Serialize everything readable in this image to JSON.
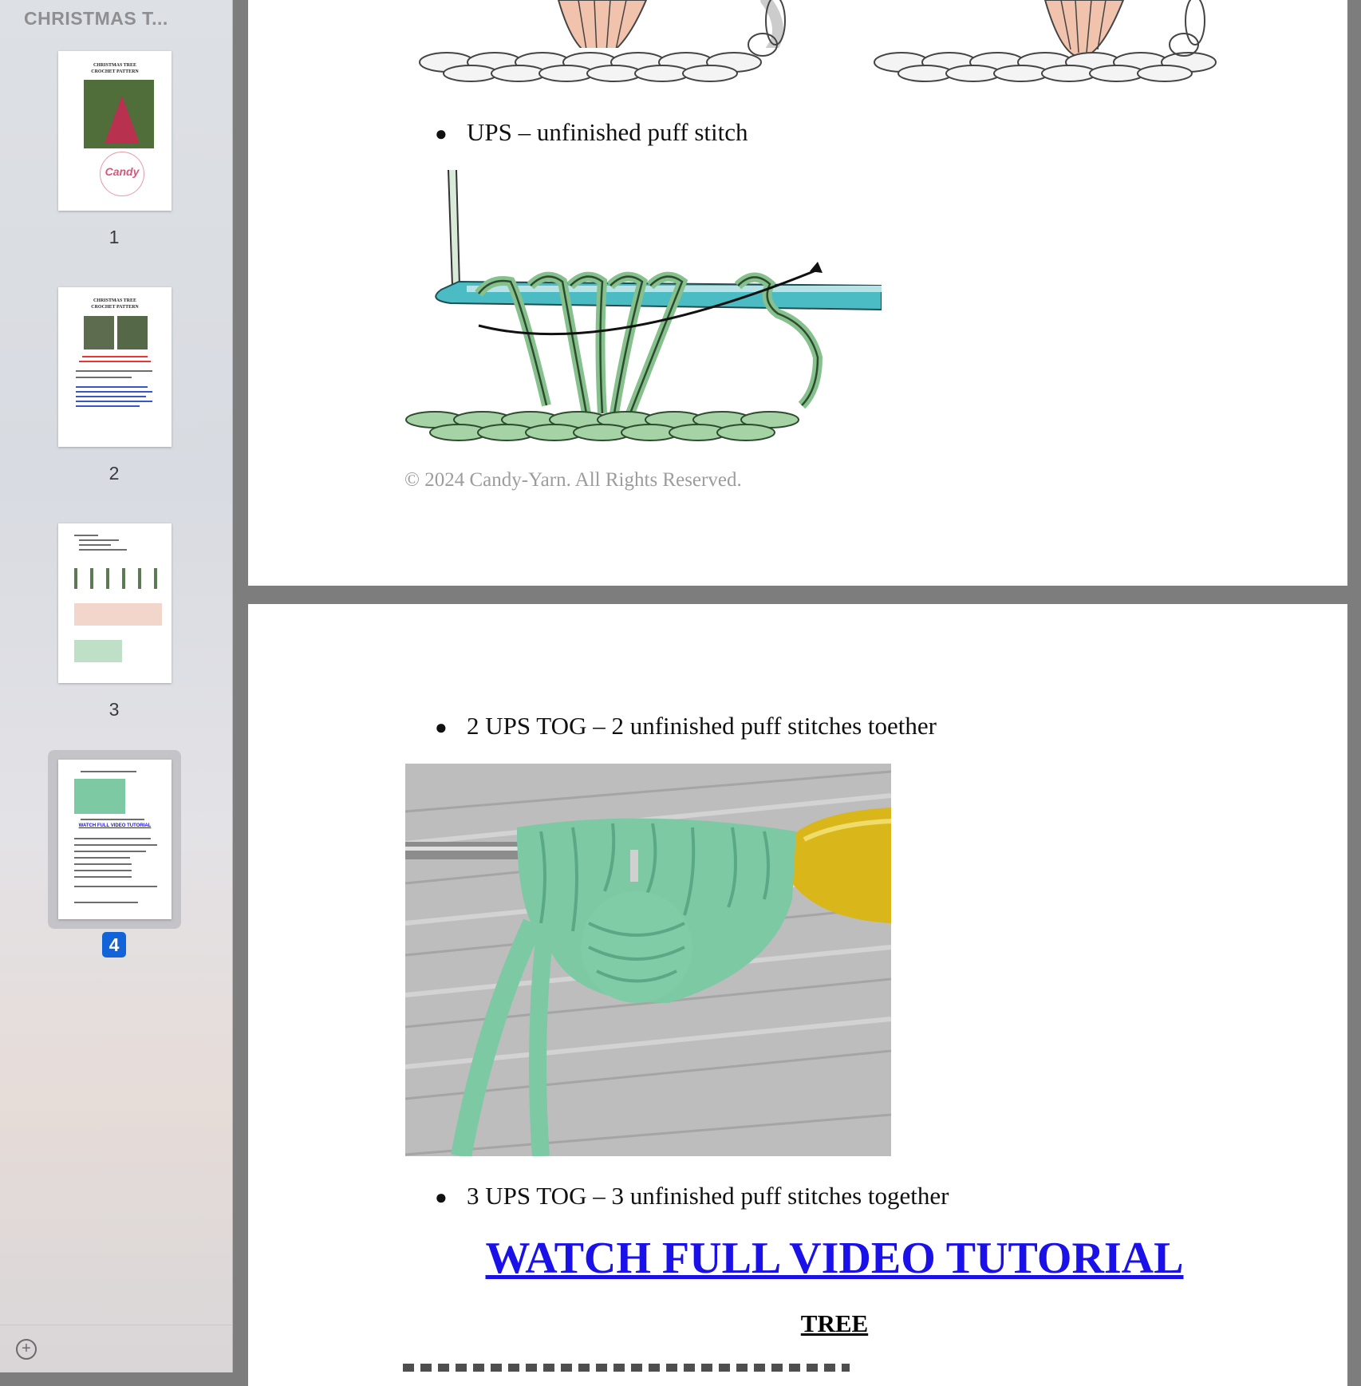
{
  "sidebar": {
    "doc_title": "CHRISTMAS T...",
    "pages": [
      {
        "number": "1",
        "title": "CHRISTMAS TREE\nCROCHET PATTERN"
      },
      {
        "number": "2",
        "title": "CHRISTMAS TREE\nCROCHET PATTERN"
      },
      {
        "number": "3",
        "title": ""
      },
      {
        "number": "4",
        "title": "",
        "link": "WATCH FULL VIDEO TUTORIAL",
        "selected": true
      }
    ],
    "add_label": "+"
  },
  "page3": {
    "bullet_ups": "UPS – unfinished puff stitch",
    "copyright": "© 2024 Candy-Yarn. All Rights Reserved."
  },
  "page4": {
    "bullet_2ups": "2 UPS TOG – 2 unfinished puff stitches toether",
    "bullet_3ups": "3 UPS TOG – 3 unfinished puff stitches together",
    "video_link": "WATCH FULL VIDEO TUTORIAL",
    "tree_heading": "TREE"
  },
  "colors": {
    "link_blue": "#1a10e8",
    "selection_blue": "#1363d8",
    "yarn_green": "#7cc9a4",
    "hook_yellow": "#d9b619"
  }
}
